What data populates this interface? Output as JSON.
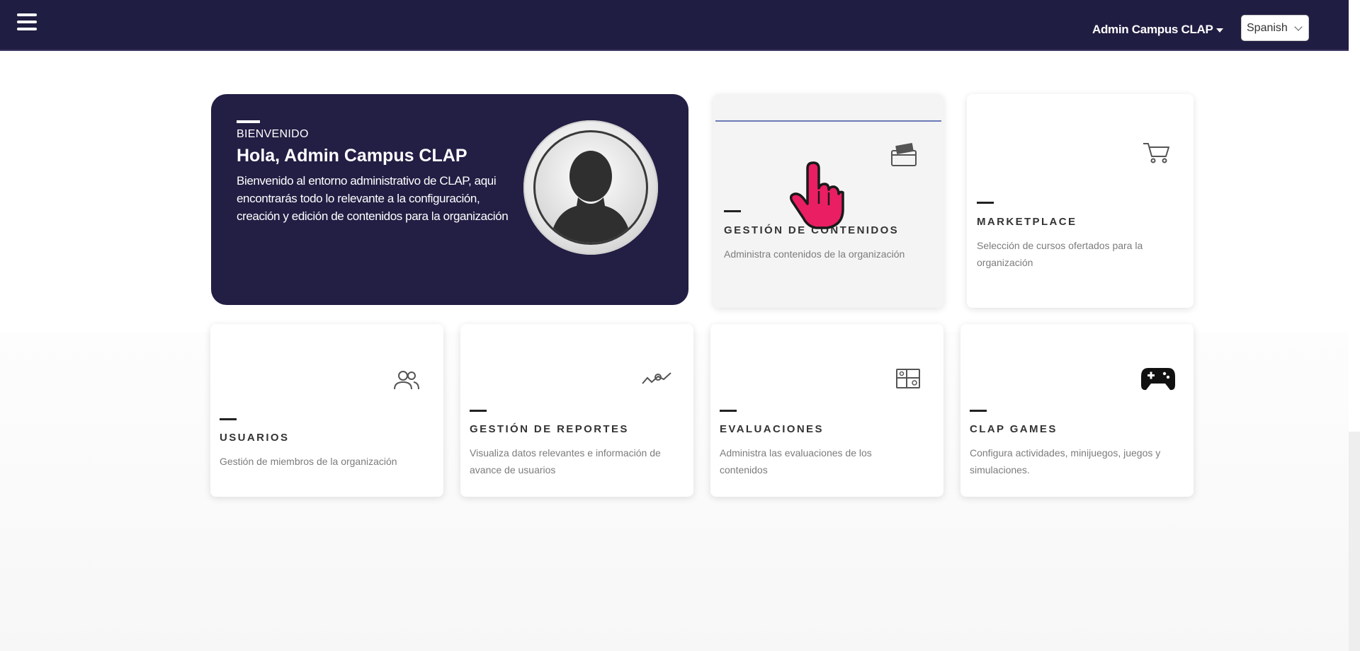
{
  "header": {
    "user_name": "Admin Campus CLAP",
    "language": "Spanish"
  },
  "welcome": {
    "kicker": "BIENVENIDO",
    "title": "Hola, Admin Campus CLAP",
    "description": "Bienvenido al entorno administrativo de CLAP, aqui encontrarás todo lo relevante a la configuración, creación y edición de contenidos para la organización"
  },
  "cards": {
    "contenidos": {
      "title": "GESTIÓN DE CONTENIDOS",
      "description": "Administra contenidos de la organización",
      "icon": "folder-icon"
    },
    "marketplace": {
      "title": "MARKETPLACE",
      "description": "Selección de cursos ofertados para la organización",
      "icon": "cart-icon"
    },
    "usuarios": {
      "title": "USUARIOS",
      "description": "Gestión de miembros de la organización",
      "icon": "users-icon"
    },
    "reportes": {
      "title": "GESTIÓN DE REPORTES",
      "description": "Visualiza datos relevantes e información de avance de usuarios",
      "icon": "analytics-icon"
    },
    "evaluaciones": {
      "title": "EVALUACIONES",
      "description": "Administra las evaluaciones de los contenidos",
      "icon": "layout-icon"
    },
    "games": {
      "title": "CLAP GAMES",
      "description": "Configura actividades, minijuegos, juegos y simulaciones.",
      "icon": "gamepad-icon"
    }
  },
  "colors": {
    "header_bg": "#201d42",
    "welcome_bg": "#221e44",
    "cursor": "#e91e63",
    "hover_line": "#6c7ab6"
  }
}
